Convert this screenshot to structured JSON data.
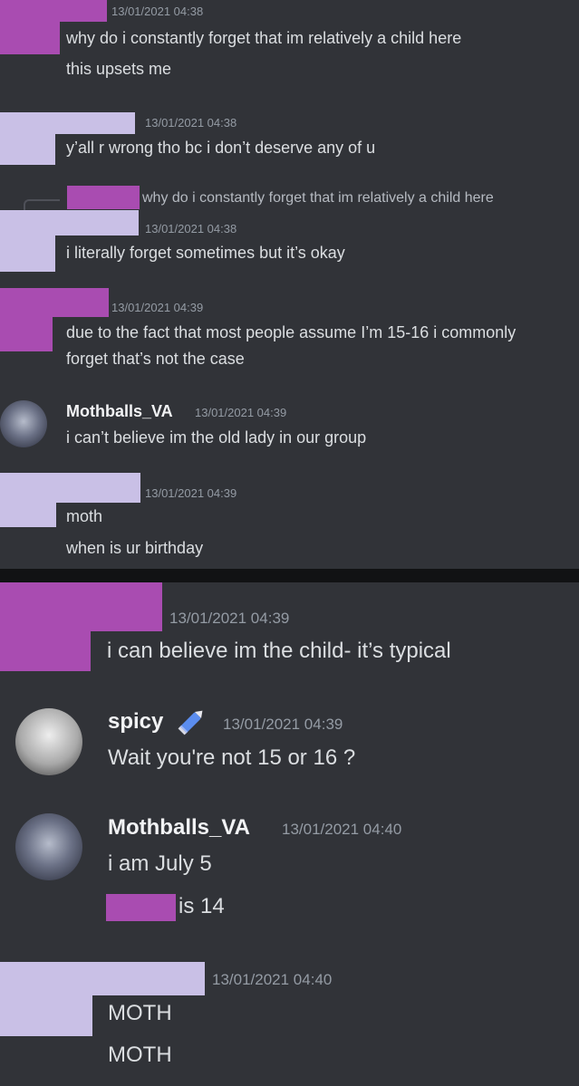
{
  "top_panel": {
    "messages": [
      {
        "timestamp": "13/01/2021 04:38",
        "lines": [
          "why do i constantly forget that im relatively a child here",
          "this upsets me"
        ]
      },
      {
        "timestamp": "13/01/2021 04:38",
        "lines": [
          "y’all r wrong tho bc i don’t deserve any of u"
        ]
      },
      {
        "reply_to": "why do i constantly forget that im relatively a child here",
        "timestamp": "13/01/2021 04:38",
        "lines": [
          "i literally forget sometimes but it’s okay"
        ]
      },
      {
        "timestamp": "13/01/2021 04:39",
        "lines": [
          "due to the fact that most people assume I’m 15-16 i commonly",
          "forget that’s not the case"
        ]
      },
      {
        "username": "Mothballs_VA",
        "timestamp": "13/01/2021 04:39",
        "lines": [
          "i can’t believe im the old lady in our group"
        ]
      },
      {
        "timestamp": "13/01/2021 04:39",
        "lines": [
          "moth",
          "when is ur birthday"
        ]
      }
    ]
  },
  "bottom_panel": {
    "messages": [
      {
        "timestamp": "13/01/2021 04:39",
        "lines": [
          "i can believe im the child- it’s typical"
        ]
      },
      {
        "username": "spicy",
        "badge_icon": "pencil-icon",
        "timestamp": "13/01/2021 04:39",
        "lines": [
          "Wait you're not 15 or 16 ?"
        ]
      },
      {
        "username": "Mothballs_VA",
        "timestamp": "13/01/2021 04:40",
        "lines": [
          "i am July 5",
          "is 14"
        ]
      },
      {
        "timestamp": "13/01/2021 04:40",
        "lines": [
          "MOTH",
          "MOTH"
        ]
      }
    ]
  },
  "colors": {
    "background": "#313338",
    "redact_purple": "#a94cb1",
    "redact_lavender": "#c9c0e6",
    "divider": "#111214"
  }
}
